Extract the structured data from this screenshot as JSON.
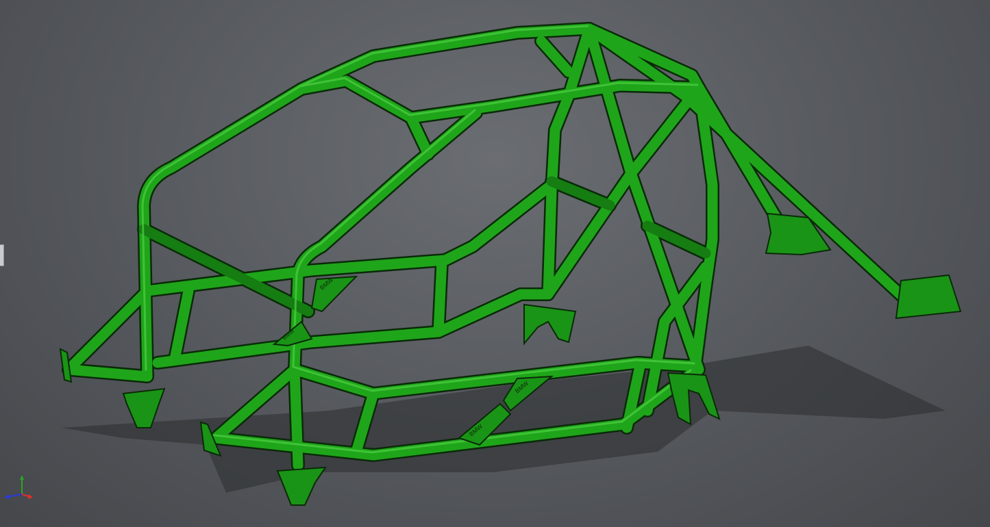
{
  "viewport": {
    "background": "#55585d",
    "model_color": "#1fa51a",
    "model_shade": "#137a10",
    "model_highlight": "#4fd044",
    "outline_color": "#0a2a08",
    "shadow_color": "#2b2d30"
  },
  "model": {
    "plates": [
      {
        "label": "BMW"
      },
      {
        "label": "BMW"
      },
      {
        "label": "BMW"
      },
      {
        "label": "BMW"
      }
    ]
  },
  "triad": {
    "x_color": "#e0302a",
    "y_color": "#2aa52a",
    "z_color": "#2a3ad8"
  }
}
